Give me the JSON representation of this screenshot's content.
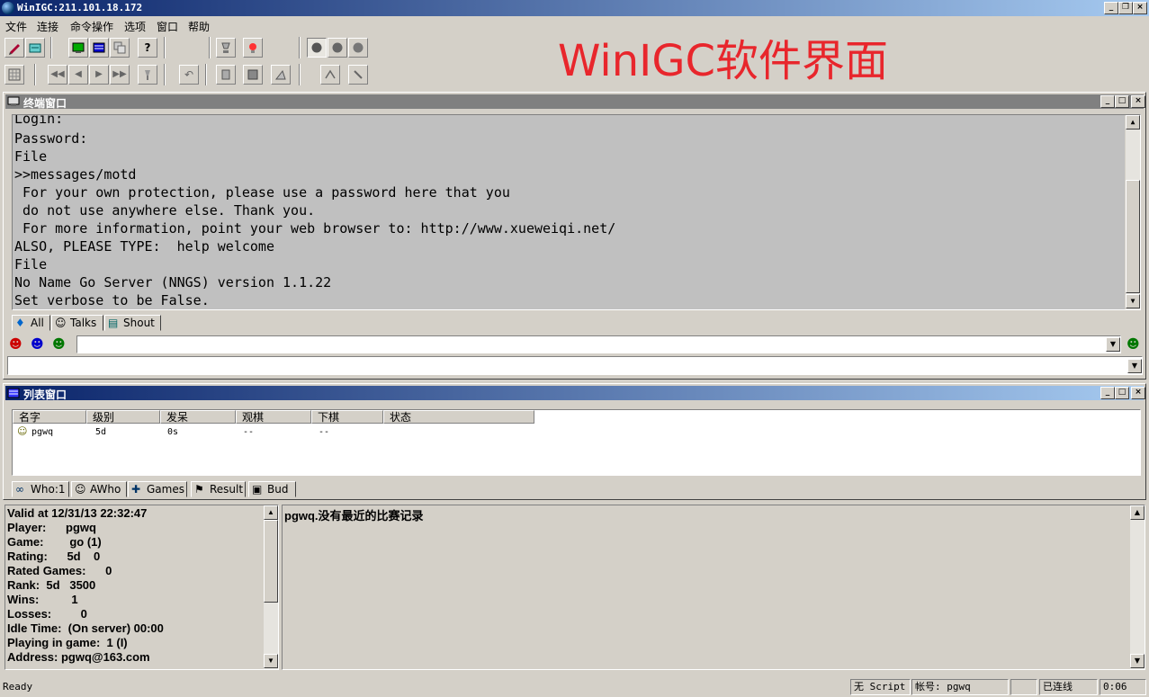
{
  "window": {
    "title": "WinIGC:211.101.18.172",
    "minimize_glyph": "_",
    "restore_glyph": "❐",
    "close_glyph": "×"
  },
  "menu": [
    "文件",
    "连接",
    "命令操作",
    "选项",
    "窗口",
    "帮助"
  ],
  "toolbar_icons": {
    "row1": [
      "connect-icon",
      "disconnect-icon",
      "terminal-window-icon",
      "list-window-icon",
      "copy-icon",
      "help-icon",
      "observe-icon",
      "alert-icon",
      "stone-black-icon",
      "stone-gray-icon",
      "stone-white-icon"
    ],
    "row2": [
      "board-icon",
      "first-move-icon",
      "previous-move-icon",
      "next-move-icon",
      "last-move-icon",
      "torch-icon",
      "undo-icon",
      "pass-icon",
      "resign-icon",
      "score-icon",
      "mark-icon",
      "pen-icon"
    ]
  },
  "banner": "WinIGC软件界面",
  "terminal": {
    "title": "终端窗口",
    "lines": [
      "Login:",
      "Password:",
      "File",
      ">>messages/motd",
      " For your own protection, please use a password here that you",
      " do not use anywhere else. Thank you.",
      " For more information, point your web browser to: http://www.xueweiqi.net/",
      "ALSO, PLEASE TYPE:  help welcome",
      "File",
      "No Name Go Server (NNGS) version 1.1.22",
      "Set verbose to be False."
    ],
    "tabs": [
      {
        "label": "All",
        "icon": "all-icon"
      },
      {
        "label": "Talks",
        "icon": "talks-icon"
      },
      {
        "label": "Shout",
        "icon": "shout-icon"
      }
    ],
    "command_input": "",
    "message_input": ""
  },
  "list_window": {
    "title": "列表窗口",
    "columns": [
      "名字",
      "级别",
      "发呆",
      "观棋",
      "下棋",
      "状态"
    ],
    "rows": [
      {
        "name": "pgwq",
        "rank": "5d",
        "idle": "0s",
        "observe": "--",
        "playing": "--",
        "status": ""
      }
    ],
    "tabs": [
      {
        "label": "Who:1",
        "icon": "binoculars-icon"
      },
      {
        "label": "AWho",
        "icon": "awho-icon"
      },
      {
        "label": "Games",
        "icon": "games-icon"
      },
      {
        "label": "Result",
        "icon": "result-icon"
      },
      {
        "label": "Bud",
        "icon": "bud-icon"
      }
    ]
  },
  "player_info": [
    "Valid at 12/31/13 22:32:47",
    "Player:      pgwq",
    "Game:        go (1)",
    "Rating:      5d    0",
    "Rated Games:      0",
    "Rank:  5d   3500",
    "Wins:          1",
    "Losses:         0",
    "Idle Time:  (On server) 00:00",
    "Playing in game:  1 (I)",
    "Address: pgwq@163.com"
  ],
  "recent_games": "pgwq.没有最近的比赛记录",
  "status": {
    "ready": "Ready",
    "script": "无 Script",
    "account": "帐号: pgwq",
    "empty": "",
    "connection": "已连线",
    "time": "0:06"
  }
}
